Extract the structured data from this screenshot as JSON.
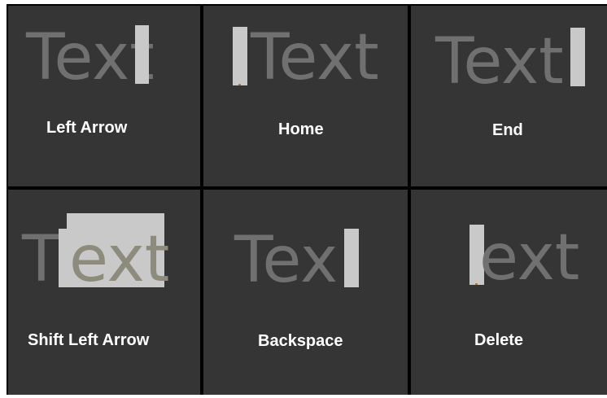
{
  "demo_word": "Text",
  "panels": [
    {
      "key": "Left Arrow",
      "shown_text": "Text"
    },
    {
      "key": "Home",
      "shown_text": "Text"
    },
    {
      "key": "End",
      "shown_text": "Text"
    },
    {
      "key": "Shift Left Arrow",
      "shown_text_before": "T",
      "shown_text_selected": "ext"
    },
    {
      "key": "Backspace",
      "shown_text": "Tex"
    },
    {
      "key": "Delete",
      "shown_text": "ext"
    }
  ],
  "colors": {
    "background": "#353535",
    "grid_lines": "#ffffff",
    "text": "#707070",
    "cursor": "#c9c9c9",
    "selected_text": "#8d8b7b",
    "label": "#ffffff"
  }
}
